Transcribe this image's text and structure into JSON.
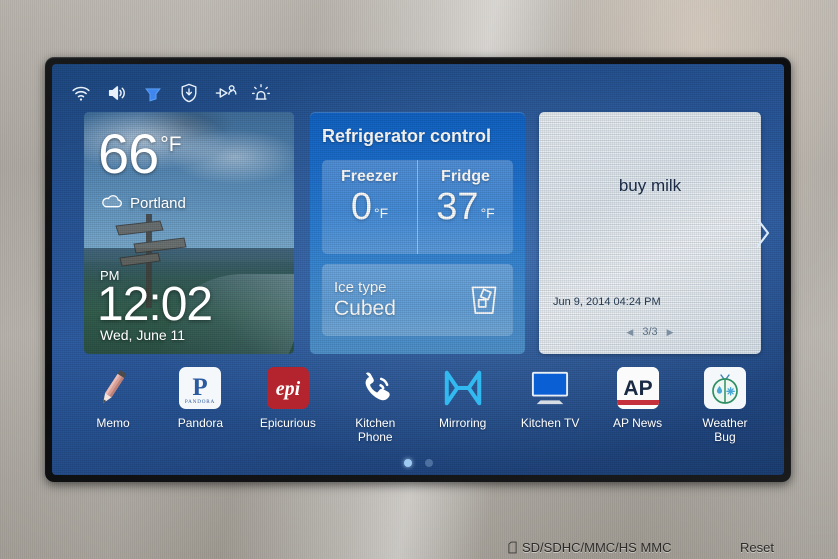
{
  "appliance": {
    "bottom_bar": {
      "sd_slot_label": "SD/SDHC/MMC/HS MMC",
      "sd_icon": "sd-card-icon",
      "reset_label": "Reset"
    }
  },
  "status_bar": {
    "icons": [
      {
        "name": "wifi-icon",
        "label": "Wi-Fi"
      },
      {
        "name": "volume-icon",
        "label": "Volume"
      },
      {
        "name": "wifi-direct-icon",
        "label": "Wi-Fi Direct"
      },
      {
        "name": "shield-download-icon",
        "label": "Secure download"
      },
      {
        "name": "device-connect-icon",
        "label": "Device connect"
      },
      {
        "name": "alarm-siren-icon",
        "label": "Alarm"
      }
    ]
  },
  "weather": {
    "temperature": "66",
    "unit": "°F",
    "city": "Portland",
    "cloud_icon": "cloud-icon",
    "meridiem": "PM",
    "time": "12:02",
    "date": "Wed, June 11"
  },
  "refrigerator": {
    "title": "Refrigerator control",
    "zones": [
      {
        "label": "Freezer",
        "value": "0",
        "unit": "°F"
      },
      {
        "label": "Fridge",
        "value": "37",
        "unit": "°F"
      }
    ],
    "ice": {
      "label": "Ice type",
      "value": "Cubed",
      "icon": "ice-glass-icon"
    }
  },
  "memo": {
    "text": "buy milk",
    "timestamp": "Jun 9, 2014 04:24 PM",
    "pager": {
      "prev_icon": "triangle-left-icon",
      "next_icon": "triangle-right-icon",
      "counter": "3/3"
    }
  },
  "navigation": {
    "next_page_icon": "chevron-right-icon",
    "page_dots": [
      {
        "active": true
      },
      {
        "active": false
      }
    ]
  },
  "dock": {
    "apps": [
      {
        "label": "Memo",
        "icon": "pencil-icon"
      },
      {
        "label": "Pandora",
        "icon": "pandora-icon",
        "wordmark": "P",
        "subtext": "PANDORA"
      },
      {
        "label": "Epicurious",
        "icon": "epicurious-icon",
        "wordmark": "epi"
      },
      {
        "label": "Kitchen\nPhone",
        "icon": "phone-icon"
      },
      {
        "label": "Mirroring",
        "icon": "mirroring-icon"
      },
      {
        "label": "Kitchen TV",
        "icon": "tv-icon"
      },
      {
        "label": "AP News",
        "icon": "ap-news-icon",
        "wordmark": "AP"
      },
      {
        "label": "Weather\nBug",
        "icon": "weather-bug-icon"
      }
    ]
  },
  "colors": {
    "screen_blue": "#2d5ea6",
    "panel_blue": "#1a6fd0",
    "memo_paper": "#e9eff4",
    "accent_cyan": "#29b6f6",
    "epi_red": "#b4242e",
    "pandora_blue": "#2c5aa0",
    "steel": "#b2ada6"
  }
}
